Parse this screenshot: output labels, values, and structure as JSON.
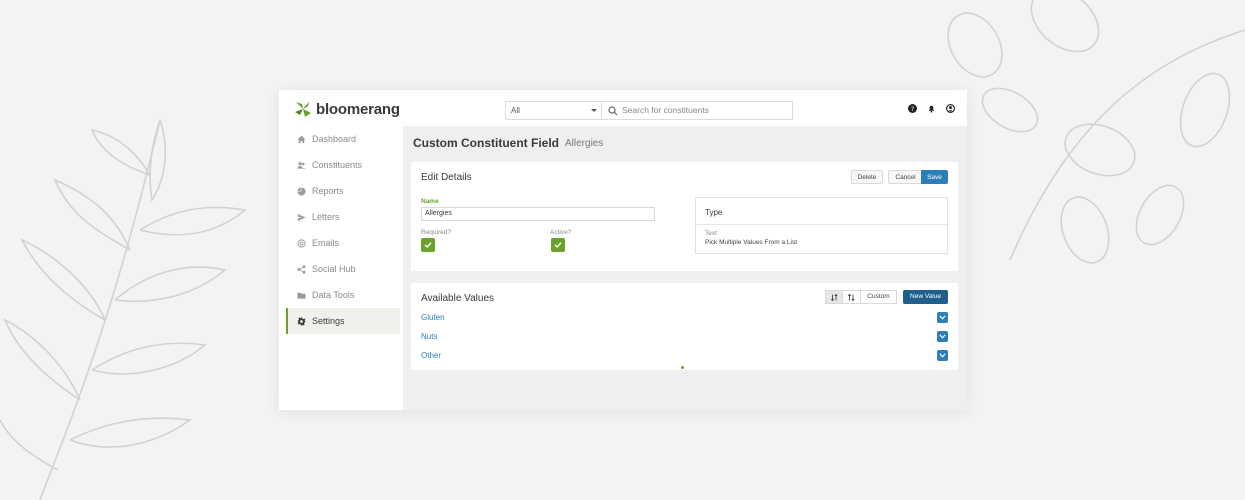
{
  "brand": {
    "name": "bloomerang",
    "color": "#6aa12b"
  },
  "search": {
    "scope": "All",
    "placeholder": "Search for constituents"
  },
  "top_icons": [
    "help-icon",
    "bell-icon",
    "user-icon"
  ],
  "sidebar": {
    "items": [
      {
        "label": "Dashboard",
        "icon": "home-icon"
      },
      {
        "label": "Constituents",
        "icon": "people-icon"
      },
      {
        "label": "Reports",
        "icon": "pie-chart-icon"
      },
      {
        "label": "Letters",
        "icon": "send-icon"
      },
      {
        "label": "Emails",
        "icon": "at-icon"
      },
      {
        "label": "Social Hub",
        "icon": "share-icon"
      },
      {
        "label": "Data Tools",
        "icon": "folder-icon"
      },
      {
        "label": "Settings",
        "icon": "gear-icon",
        "active": true
      }
    ]
  },
  "page": {
    "title": "Custom Constituent Field",
    "subtitle": "Allergies"
  },
  "edit_details": {
    "title": "Edit Details",
    "delete_label": "Delete",
    "cancel_label": "Cancel",
    "save_label": "Save",
    "name_label": "Name",
    "name_value": "Allergies",
    "required_label": "Required?",
    "required_checked": true,
    "active_label": "Active?",
    "active_checked": true,
    "type_title": "Type",
    "type_kind": "Text",
    "type_value": "Pick Multiple Values From a List"
  },
  "available_values": {
    "title": "Available Values",
    "custom_label": "Custom",
    "new_value_label": "New Value",
    "items": [
      "Gluten",
      "Nuts",
      "Other"
    ]
  },
  "colors": {
    "accent": "#2d7fb8",
    "primary_dark": "#1f5f8b",
    "green": "#6aa12b"
  }
}
